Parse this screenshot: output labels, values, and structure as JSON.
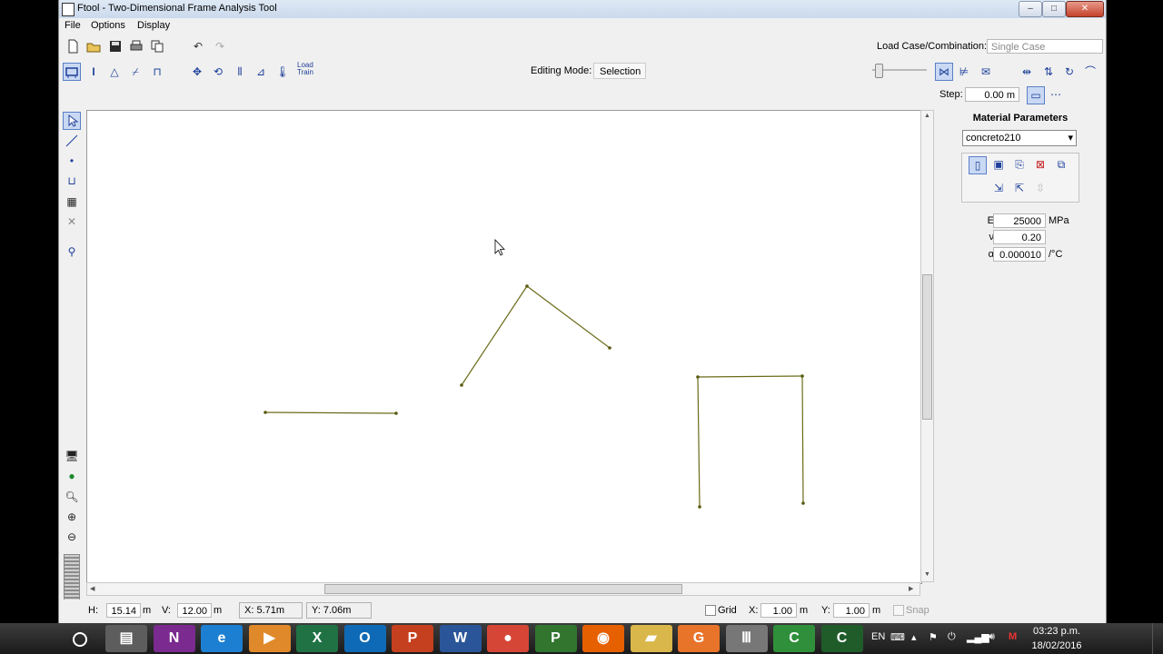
{
  "window": {
    "title": "Ftool - Two-Dimensional Frame Analysis Tool",
    "minimize_glyph": "–",
    "maximize_glyph": "□",
    "close_glyph": "✕"
  },
  "menu": [
    "File",
    "Options",
    "Display"
  ],
  "toolbar": {
    "load_case_label": "Load Case/Combination:",
    "load_case_value": "Single Case",
    "editing_mode_label": "Editing Mode:",
    "editing_mode_value": "Selection",
    "load_train_label": "Load Train"
  },
  "step": {
    "label": "Step:",
    "value": "0.00 m"
  },
  "material": {
    "title": "Material Parameters",
    "selected": "concreto210",
    "dropdown_arrow": "▾",
    "params": [
      {
        "symbol": "E:",
        "value": "25000",
        "unit": "MPa"
      },
      {
        "symbol": "ν:",
        "value": "0.20",
        "unit": ""
      },
      {
        "symbol": "α:",
        "value": "0.000010",
        "unit": "/°C"
      }
    ]
  },
  "status": {
    "h_label": "H:",
    "h_value": "15.14",
    "h_unit": "m",
    "v_label": "V:",
    "v_value": "12.00",
    "v_unit": "m",
    "x_coord": "X: 5.71m",
    "y_coord": "Y: 7.06m",
    "grid_label": "Grid",
    "grid_x_label": "X:",
    "grid_x_value": "1.00",
    "grid_x_unit": "m",
    "grid_y_label": "Y:",
    "grid_y_value": "1.00",
    "grid_y_unit": "m",
    "snap_label": "Snap"
  },
  "canvas": {
    "line_color": "#6b6b1a",
    "node_color": "#5a5a10"
  },
  "taskbar": {
    "apps": [
      {
        "name": "file-explorer",
        "glyph": "▤",
        "color": "#5d5d5d"
      },
      {
        "name": "onenote",
        "glyph": "N",
        "color": "#7b2a8f"
      },
      {
        "name": "internet-explorer",
        "glyph": "e",
        "color": "#1c7fd1"
      },
      {
        "name": "media-player",
        "glyph": "▶",
        "color": "#e0892a"
      },
      {
        "name": "excel",
        "glyph": "X",
        "color": "#207245"
      },
      {
        "name": "outlook",
        "glyph": "O",
        "color": "#0e6ab6"
      },
      {
        "name": "powerpoint",
        "glyph": "P",
        "color": "#c5401f"
      },
      {
        "name": "word",
        "glyph": "W",
        "color": "#2a5699"
      },
      {
        "name": "chrome",
        "glyph": "●",
        "color": "#d64637"
      },
      {
        "name": "project",
        "glyph": "P",
        "color": "#31752f"
      },
      {
        "name": "firefox",
        "glyph": "◉",
        "color": "#e66000"
      },
      {
        "name": "folder",
        "glyph": "▰",
        "color": "#d9b74a"
      },
      {
        "name": "pdf-tool",
        "glyph": "G",
        "color": "#e8742a"
      },
      {
        "name": "ftool",
        "glyph": "Ⅲ",
        "color": "#777777"
      },
      {
        "name": "camtasia-green",
        "glyph": "C",
        "color": "#2f8f3a"
      },
      {
        "name": "camtasia-recorder",
        "glyph": "C",
        "color": "#1f5c2a"
      }
    ],
    "lang": "EN",
    "time": "03:23 p.m.",
    "date": "18/02/2016"
  }
}
